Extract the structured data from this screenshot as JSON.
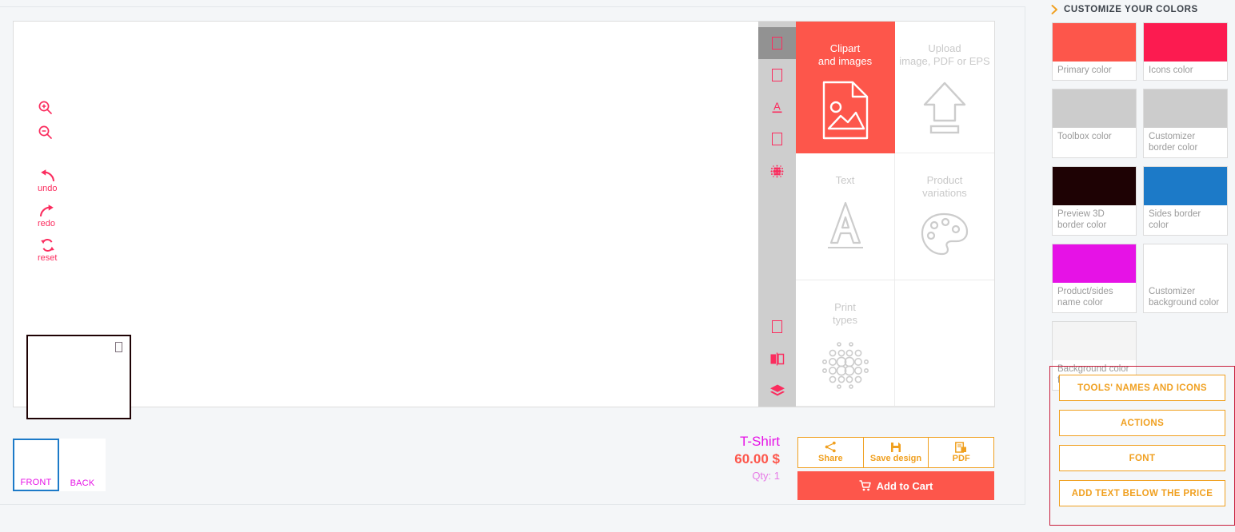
{
  "customizer": {
    "left_tools": [
      {
        "name": "zoom-in",
        "icon": "magnifier-plus-icon",
        "label": ""
      },
      {
        "name": "zoom-out",
        "icon": "magnifier-minus-icon",
        "label": ""
      },
      {
        "name": "undo",
        "icon": "undo-arrow-icon",
        "label": "undo"
      },
      {
        "name": "redo",
        "icon": "redo-arrow-icon",
        "label": "redo"
      },
      {
        "name": "reset",
        "icon": "reset-circular-arrows-icon",
        "label": "reset"
      }
    ],
    "icon_strip": [
      {
        "name": "clipart-tool",
        "icon": "missing-glyph-box-icon",
        "active": true
      },
      {
        "name": "upload-tool",
        "icon": "missing-glyph-box-icon",
        "active": false
      },
      {
        "name": "text-tool",
        "icon": "underlined-a-icon",
        "active": false
      },
      {
        "name": "product-variations-tool",
        "icon": "missing-glyph-box-icon",
        "active": false
      },
      {
        "name": "print-types-tool",
        "icon": "halftone-dots-icon",
        "active": false
      },
      {
        "name": "extra-tool",
        "icon": "missing-glyph-box-icon",
        "active": false
      },
      {
        "name": "flip-tool",
        "icon": "flip-mirror-icon",
        "active": false
      },
      {
        "name": "layers-tool",
        "icon": "layers-stack-icon",
        "active": false
      }
    ],
    "toolbox_cells": [
      {
        "name": "clipart-and-images",
        "label": "Clipart\nand images",
        "icon": "image-file-icon",
        "selected": true,
        "blank": false
      },
      {
        "name": "upload-image",
        "label": "Upload\nimage, PDF or EPS",
        "icon": "upload-arrow-icon",
        "selected": false,
        "blank": false
      },
      {
        "name": "text",
        "label": "Text",
        "icon": "letter-a-icon",
        "selected": false,
        "blank": false
      },
      {
        "name": "product-variations",
        "label": "Product\nvariations",
        "icon": "paint-palette-icon",
        "selected": false,
        "blank": false
      },
      {
        "name": "print-types",
        "label": "Print\ntypes",
        "icon": "halftone-circles-icon",
        "selected": false,
        "blank": false
      },
      {
        "name": "empty-cell",
        "label": "",
        "icon": "",
        "selected": false,
        "blank": true
      }
    ],
    "thumbnails": [
      {
        "name": "front",
        "label": "FRONT",
        "selected": true
      },
      {
        "name": "back",
        "label": "BACK",
        "selected": false
      }
    ],
    "product": {
      "name": "T-Shirt",
      "price": "60.00 $",
      "qty": "Qty: 1"
    },
    "action_buttons": [
      {
        "name": "share",
        "label": "Share",
        "icon": "share-nodes-icon"
      },
      {
        "name": "save-design",
        "label": "Save design",
        "icon": "floppy-disk-icon"
      },
      {
        "name": "pdf",
        "label": "PDF",
        "icon": "pdf-document-icon"
      }
    ],
    "cart_button": {
      "label": "Add to Cart",
      "icon": "shopping-cart-icon"
    }
  },
  "panel": {
    "header": {
      "label": "CUSTOMIZE YOUR COLORS",
      "icon": "chevron-right-icon"
    },
    "swatches": [
      {
        "name": "primary-color",
        "caption": "Primary color",
        "color": "#fd564b"
      },
      {
        "name": "icons-color",
        "caption": "Icons color",
        "color": "#fc1b50"
      },
      {
        "name": "toolbox-color",
        "caption": "Toolbox color",
        "color": "#cccccc"
      },
      {
        "name": "customizer-border-color",
        "caption": "Customizer border color",
        "color": "#cccccc"
      },
      {
        "name": "preview-3d-border-color",
        "caption": "Preview 3D border color",
        "color": "#1e0204"
      },
      {
        "name": "sides-border-color",
        "caption": "Sides border color",
        "color": "#1c7ac8"
      },
      {
        "name": "product-sides-name-color",
        "caption": "Product/sides name color",
        "color": "#e612e6"
      },
      {
        "name": "customizer-background-color",
        "caption": "Customizer background color",
        "color": "#ffffff"
      },
      {
        "name": "background-color-for-thumbnails",
        "caption": "Background color for thumbnails",
        "color": "#f4f4f4"
      }
    ],
    "buttons": [
      {
        "name": "tools-names-and-icons",
        "label": "TOOLS' NAMES AND ICONS"
      },
      {
        "name": "actions",
        "label": "ACTIONS"
      },
      {
        "name": "font",
        "label": "FONT"
      },
      {
        "name": "add-text-below-price",
        "label": "ADD TEXT BELOW THE PRICE"
      }
    ],
    "accent_border_color": "#c81e3c",
    "button_color": "#f0a020"
  }
}
